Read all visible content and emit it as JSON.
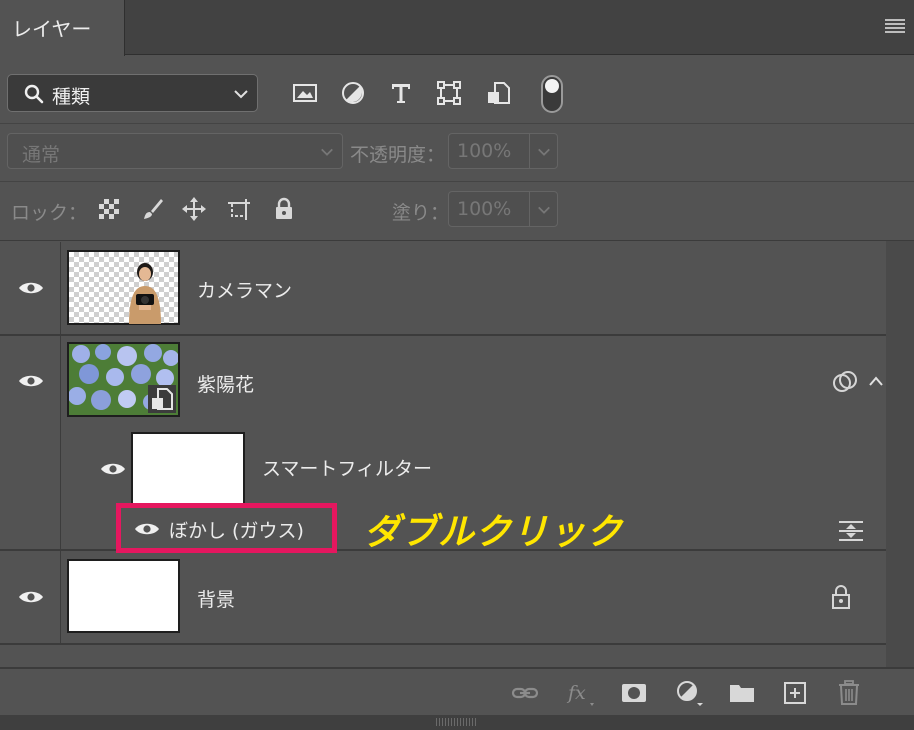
{
  "panel": {
    "tab_label": "レイヤー"
  },
  "filter": {
    "kind_label": "種類"
  },
  "blend": {
    "mode": "通常",
    "opacity_label": "不透明度：",
    "opacity_value": "100%"
  },
  "lock": {
    "label": "ロック：",
    "fill_label": "塗り：",
    "fill_value": "100%"
  },
  "layers": [
    {
      "name": "カメラマン",
      "visible": true
    },
    {
      "name": "紫陽花",
      "visible": true,
      "smart_object": true
    },
    {
      "name": "スマートフィルター",
      "visible": true
    },
    {
      "name": "ぼかし (ガウス)",
      "visible": true
    },
    {
      "name": "背景",
      "visible": true,
      "locked": true
    }
  ],
  "annotation": {
    "callout_text": "ダブルクリック",
    "highlight_color": "#e5175f",
    "callout_color": "#ffe600"
  },
  "icons": {
    "filter": [
      "image-icon",
      "adjustment-icon",
      "type-icon",
      "shape-icon",
      "smart-object-icon"
    ],
    "lock": [
      "lock-transparent-pixels-icon",
      "lock-image-pixels-icon",
      "lock-position-icon",
      "lock-artboard-icon",
      "lock-all-icon"
    ],
    "bottom": [
      "link-layers-icon",
      "fx-icon",
      "layer-mask-icon",
      "adjustment-layer-icon",
      "group-folder-icon",
      "new-layer-icon",
      "trash-icon"
    ]
  }
}
